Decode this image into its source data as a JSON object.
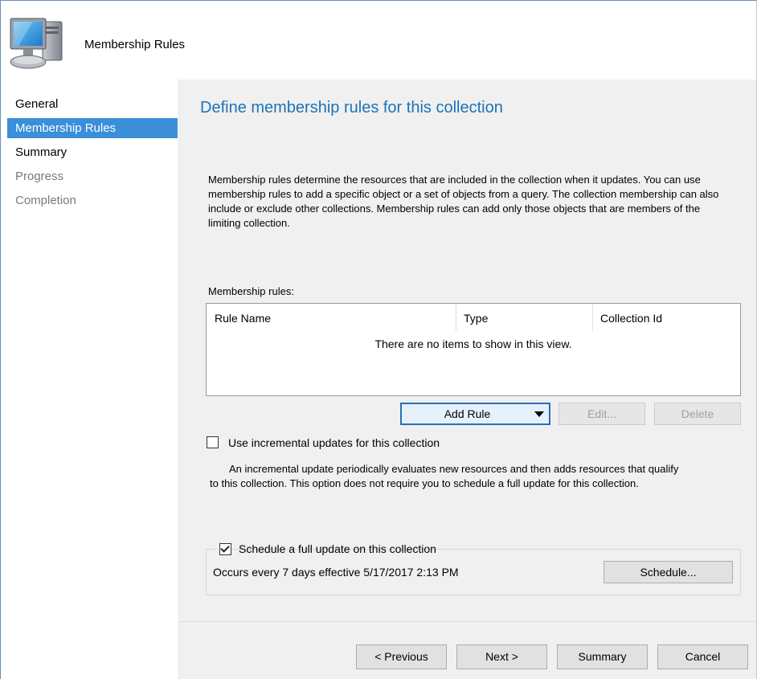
{
  "header": {
    "title": "Membership Rules",
    "icon": "computer-icon"
  },
  "nav": {
    "items": [
      {
        "label": "General",
        "state": "normal"
      },
      {
        "label": "Membership Rules",
        "state": "active"
      },
      {
        "label": "Summary",
        "state": "normal"
      },
      {
        "label": "Progress",
        "state": "disabled"
      },
      {
        "label": "Completion",
        "state": "disabled"
      }
    ]
  },
  "page": {
    "title": "Define membership rules for this collection",
    "description": "Membership rules determine the resources that are included in the collection when it updates. You can use membership rules to add a specific object or a set of objects from a query. The collection membership can also include or exclude other collections. Membership rules can add only those objects that are members of the limiting collection."
  },
  "rules": {
    "label": "Membership rules:",
    "columns": [
      "Rule Name",
      "Type",
      "Collection Id"
    ],
    "empty_message": "There are no items to show in this view.",
    "add_rule": "Add Rule",
    "edit": "Edit...",
    "delete": "Delete"
  },
  "incremental": {
    "checked": false,
    "label": "Use incremental updates for this collection",
    "desc_line1": "An incremental update periodically evaluates new resources and then adds resources that qualify",
    "desc_line2": "to this collection. This option does not require you to schedule a full update for this collection."
  },
  "schedule": {
    "checked": true,
    "label": "Schedule a full update on this collection",
    "occurs": "Occurs every 7 days effective 5/17/2017 2:13 PM",
    "button": "Schedule..."
  },
  "footer": {
    "previous": "< Previous",
    "next": "Next >",
    "summary": "Summary",
    "cancel": "Cancel"
  },
  "colors": {
    "accent": "#3a8fd8",
    "title_blue": "#1a73b8"
  }
}
